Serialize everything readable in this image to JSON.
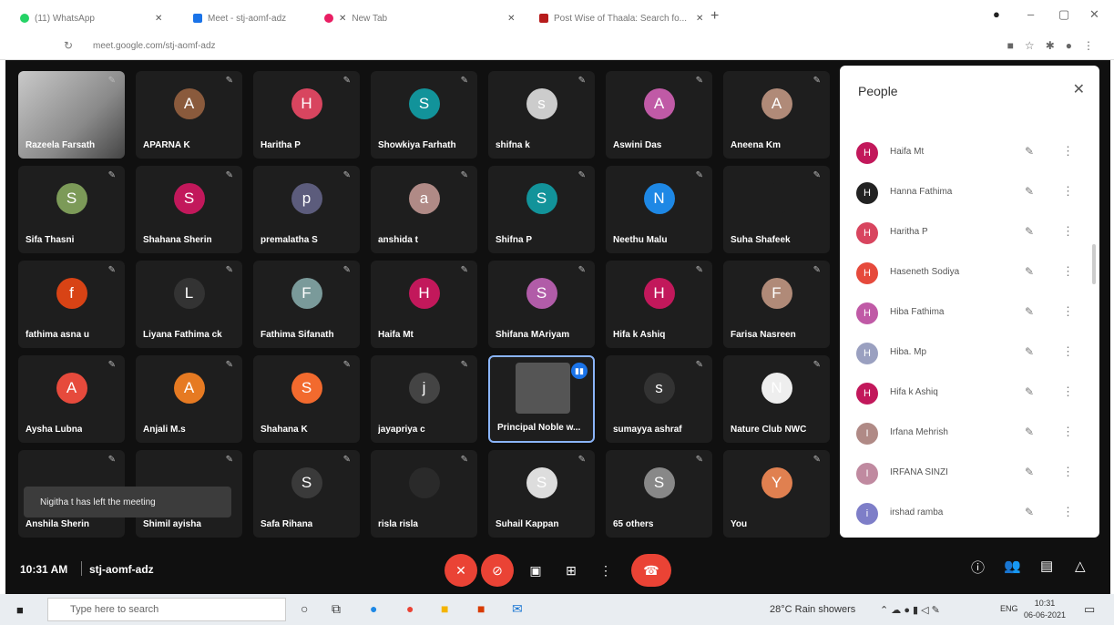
{
  "browser": {
    "tabs": [
      {
        "label": "(11) WhatsApp",
        "color": "#25d366"
      },
      {
        "label": "Meet - stj-aomf-adz",
        "color": "#1a73e8"
      },
      {
        "label": "New Tab",
        "color": "#e91e63"
      },
      {
        "label": "Post Wise of Thaala: Search fo...",
        "color": "#b71c1c"
      }
    ],
    "url": "meet.google.com/stj-aomf-adz"
  },
  "grid": {
    "tiles": [
      {
        "name": "Razeela Farsath",
        "initial": "",
        "color": "#555",
        "kind": "photo"
      },
      {
        "name": "APARNA K",
        "initial": "A",
        "color": "#8a5a3c",
        "kind": "avatar"
      },
      {
        "name": "Haritha P",
        "initial": "H",
        "color": "#d8455f",
        "kind": "avatar"
      },
      {
        "name": "Showkiya Farhath",
        "initial": "S",
        "color": "#12939a",
        "kind": "avatar"
      },
      {
        "name": "shifna k",
        "initial": "s",
        "color": "#ccc",
        "kind": "avatar"
      },
      {
        "name": "Aswini Das",
        "initial": "A",
        "color": "#c05aa6",
        "kind": "avatar"
      },
      {
        "name": "Aneena Km",
        "initial": "A",
        "color": "#b08a78",
        "kind": "avatar"
      },
      {
        "name": "Sifa Thasni",
        "initial": "S",
        "color": "#7c9a58",
        "kind": "avatar"
      },
      {
        "name": "Shahana Sherin",
        "initial": "S",
        "color": "#c2185b",
        "kind": "avatar"
      },
      {
        "name": "premalatha S",
        "initial": "p",
        "color": "#5c5c7c",
        "kind": "avatar"
      },
      {
        "name": "anshida t",
        "initial": "a",
        "color": "#b08a86",
        "kind": "avatar"
      },
      {
        "name": "Shifna P",
        "initial": "S",
        "color": "#12939a",
        "kind": "avatar"
      },
      {
        "name": "Neethu Malu",
        "initial": "N",
        "color": "#1e88e5",
        "kind": "avatar"
      },
      {
        "name": "Suha Shafeek",
        "initial": "",
        "color": "#1e1e1e",
        "kind": "avatar"
      },
      {
        "name": "fathima asna u",
        "initial": "f",
        "color": "#d84315",
        "kind": "avatar"
      },
      {
        "name": "Liyana Fathima ck",
        "initial": "L",
        "color": "#333",
        "kind": "avatar"
      },
      {
        "name": "Fathima Sifanath",
        "initial": "F",
        "color": "#7a9a9a",
        "kind": "avatar"
      },
      {
        "name": "Haifa Mt",
        "initial": "H",
        "color": "#c2185b",
        "kind": "avatar"
      },
      {
        "name": "Shifana MAriyam",
        "initial": "S",
        "color": "#b15ca8",
        "kind": "avatar"
      },
      {
        "name": "Hifa k Ashiq",
        "initial": "H",
        "color": "#c2185b",
        "kind": "avatar"
      },
      {
        "name": "Farisa Nasreen",
        "initial": "F",
        "color": "#b08a78",
        "kind": "avatar"
      },
      {
        "name": "Aysha Lubna",
        "initial": "A",
        "color": "#e64a3c",
        "kind": "avatar"
      },
      {
        "name": "Anjali M.s",
        "initial": "A",
        "color": "#e67a22",
        "kind": "avatar"
      },
      {
        "name": "Shahana K",
        "initial": "S",
        "color": "#f26a2e",
        "kind": "avatar"
      },
      {
        "name": "jayapriya c",
        "initial": "j",
        "color": "#444",
        "kind": "avatar"
      },
      {
        "name": "Principal Noble w...",
        "initial": "",
        "color": "#555",
        "kind": "speaking"
      },
      {
        "name": "sumayya ashraf",
        "initial": "s",
        "color": "#333",
        "kind": "avatar"
      },
      {
        "name": "Nature Club NWC",
        "initial": "N",
        "color": "#eee",
        "kind": "avatar"
      },
      {
        "name": "Anshila Sherin",
        "initial": "",
        "color": "#1e1e1e",
        "kind": "blank"
      },
      {
        "name": "Shimil ayisha",
        "initial": "",
        "color": "#1e1e1e",
        "kind": "blank"
      },
      {
        "name": "Safa Rihana",
        "initial": "S",
        "color": "#3a3a3a",
        "kind": "avatar"
      },
      {
        "name": "risla risla",
        "initial": "",
        "color": "#2a2a2a",
        "kind": "avatar"
      },
      {
        "name": "Suhail Kappan",
        "initial": "S",
        "color": "#ddd",
        "kind": "avatar"
      },
      {
        "name": "65 others",
        "initial": "S",
        "color": "#888",
        "kind": "avatar"
      },
      {
        "name": "You",
        "initial": "Y",
        "color": "#e08050",
        "kind": "avatar"
      }
    ]
  },
  "toast": "Nigitha t has left the meeting",
  "bottombar": {
    "time": "10:31 AM",
    "code": "stj-aomf-adz"
  },
  "people": {
    "title": "People",
    "rows": [
      {
        "name": "Haifa Mt",
        "initial": "H",
        "color": "#c2185b"
      },
      {
        "name": "Hanna Fathima",
        "initial": "H",
        "color": "#222"
      },
      {
        "name": "Haritha P",
        "initial": "H",
        "color": "#d8455f"
      },
      {
        "name": "Haseneth Sodiya",
        "initial": "H",
        "color": "#e64a3c"
      },
      {
        "name": "Hiba Fathima",
        "initial": "H",
        "color": "#c05aa6"
      },
      {
        "name": "Hiba. Mp",
        "initial": "H",
        "color": "#9aa0c0"
      },
      {
        "name": "Hifa k Ashiq",
        "initial": "H",
        "color": "#c2185b"
      },
      {
        "name": "Irfana Mehrish",
        "initial": "I",
        "color": "#b08a86"
      },
      {
        "name": "IRFANA SINZI",
        "initial": "I",
        "color": "#c08aa0"
      },
      {
        "name": "irshad ramba",
        "initial": "i",
        "color": "#7e7ec8"
      }
    ]
  },
  "taskbar": {
    "search_placeholder": "Type here to search",
    "weather": "28°C  Rain showers",
    "lang": "ENG",
    "clock_time": "10:31",
    "clock_date": "06-06-2021"
  }
}
